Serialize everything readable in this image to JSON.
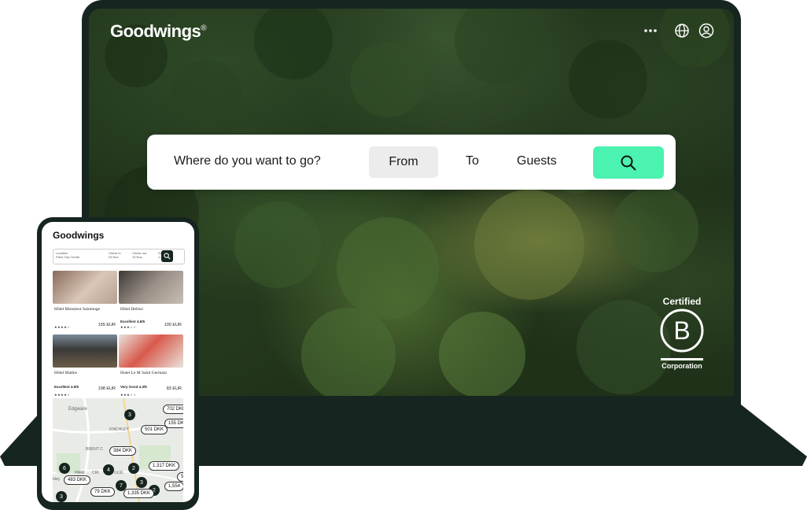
{
  "desktop": {
    "brand": "Goodwings",
    "brand_mark": "®",
    "header_icons": [
      "more-icon",
      "globe-icon",
      "user-icon"
    ],
    "search": {
      "destination_placeholder": "Where do you want to go?",
      "from_label": "From",
      "to_label": "To",
      "guests_label": "Guests",
      "button_icon": "search-icon",
      "button_color": "#4bf2b0"
    },
    "badge": {
      "top": "Certified",
      "letter": "B",
      "bottom": "Corporation"
    }
  },
  "mobile": {
    "brand": "Goodwings",
    "search_fields": [
      {
        "label": "Location",
        "value": "Paris City Centre"
      },
      {
        "label": "Check in",
        "value": "03 Nov"
      },
      {
        "label": "Check out",
        "value": "10 Nov"
      },
      {
        "label": "Guests",
        "value": "1 adult"
      }
    ],
    "hotels": [
      {
        "name": "Hôtel Monsieur Saintonge",
        "rating": "",
        "stars": 4,
        "price": "155",
        "currency": "EUR"
      },
      {
        "name": "Hôtel Helissi",
        "rating": "Excellent 4.6/5",
        "stars": 3,
        "price": "100",
        "currency": "EUR"
      },
      {
        "name": "Hôtel Mathis",
        "rating": "Excellent 4.5/5",
        "stars": 4,
        "price": "198",
        "currency": "EUR"
      },
      {
        "name": "Hotel Le M Saint Germain",
        "rating": "Very Good 4.3/5",
        "stars": 3,
        "price": "83",
        "currency": "EUR"
      }
    ],
    "map": {
      "place_labels": [
        "Edgware",
        "FINCHLEY",
        "BRENT C",
        "PARK",
        "CRI",
        "OOD",
        "bley"
      ],
      "clusters": [
        "3",
        "6",
        "4",
        "2",
        "7",
        "3",
        "3",
        "2"
      ],
      "prices": [
        "702 DKK",
        "155 DK",
        "501 DKK",
        "384 DKK",
        "1,317 DKK",
        "5",
        "483 DKK",
        "1,554",
        "79 DKK",
        "1,335 DKK"
      ]
    }
  }
}
